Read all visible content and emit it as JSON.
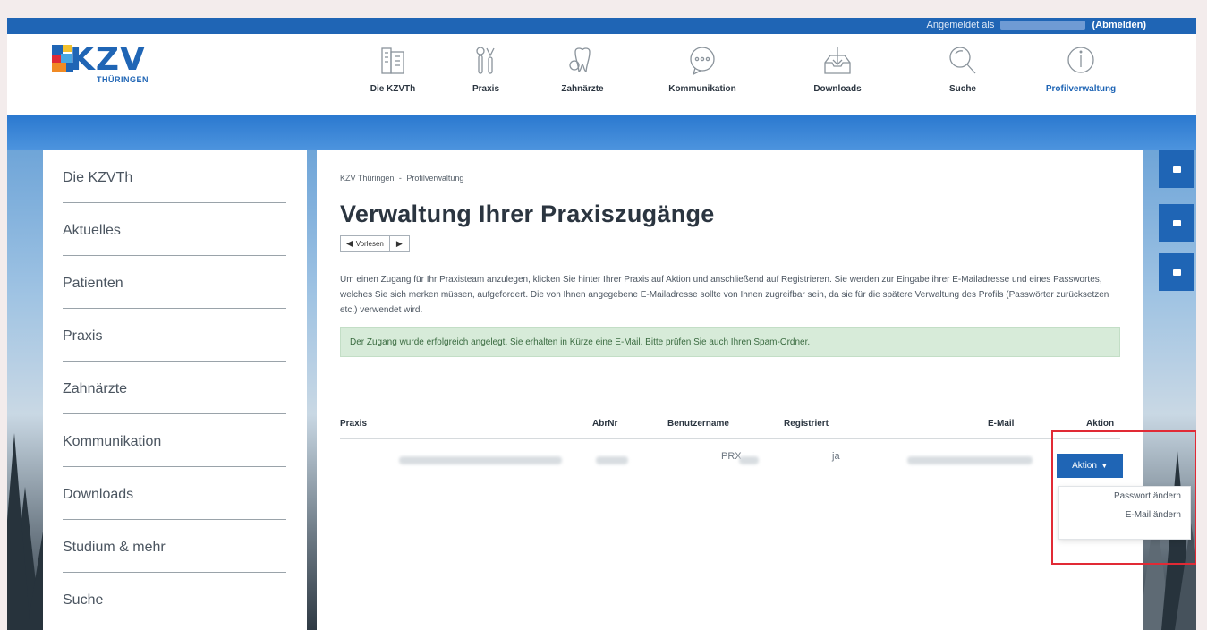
{
  "login_bar": {
    "prefix": "Angemeldet als",
    "logout": "(Abmelden)"
  },
  "logo": {
    "word": "KZV",
    "sub": "THÜRINGEN"
  },
  "nav": [
    {
      "label": "Die KZVTh",
      "icon": "building-icon"
    },
    {
      "label": "Praxis",
      "icon": "tools-icon"
    },
    {
      "label": "Zahnärzte",
      "icon": "tooth-icon"
    },
    {
      "label": "Kommunikation",
      "icon": "chat-bubble-icon"
    },
    {
      "label": "Downloads",
      "icon": "download-tray-icon"
    },
    {
      "label": "Suche",
      "icon": "search-icon"
    },
    {
      "label": "Profilverwaltung",
      "icon": "info-icon",
      "active": true
    }
  ],
  "sidebar": {
    "items": [
      "Die KZVTh",
      "Aktuelles",
      "Patienten",
      "Praxis",
      "Zahnärzte",
      "Kommunikation",
      "Downloads",
      "Studium & mehr",
      "Suche"
    ]
  },
  "breadcrumb": {
    "home": "KZV Thüringen",
    "sep": "-",
    "current": "Profilverwaltung"
  },
  "page_title": "Verwaltung Ihrer Praxiszugänge",
  "readspeaker": {
    "listen": "Vorlesen",
    "play": "▶"
  },
  "intro": "Um einen Zugang für Ihr Praxisteam anzulegen, klicken Sie hinter Ihrer Praxis auf Aktion und anschließend auf Registrieren. Sie werden zur Eingabe ihrer E-Mailadresse und eines Passwortes, welches Sie sich merken müssen, aufgefordert. Die von Ihnen angegebene E-Mailadresse sollte von Ihnen zugreifbar sein, da sie für die spätere Verwaltung des Profils (Passwörter zurücksetzen etc.) verwendet wird.",
  "alert": "Der Zugang wurde erfolgreich angelegt. Sie erhalten in Kürze eine E-Mail. Bitte prüfen Sie auch Ihren Spam-Ordner.",
  "table": {
    "headers": {
      "praxis": "Praxis",
      "abrnr": "AbrNr",
      "benutzername": "Benutzername",
      "registriert": "Registriert",
      "email": "E-Mail",
      "aktion": "Aktion"
    },
    "row": {
      "benutzername_prefix": "PRX",
      "registriert": "ja"
    }
  },
  "action_button": {
    "label": "Aktion",
    "caret": "▼"
  },
  "dropdown": [
    "Passwort ändern",
    "E-Mail ändern"
  ],
  "colors": {
    "brand_blue": "#1f65b5",
    "alert_green": "#d7ebd9",
    "highlight_red": "#e12a35"
  }
}
